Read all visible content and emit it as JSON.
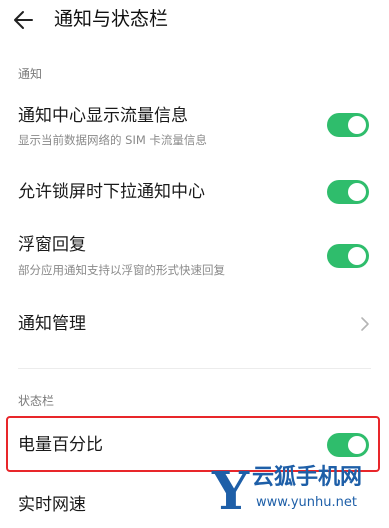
{
  "header": {
    "title": "通知与状态栏",
    "back_icon": "arrow-left-icon"
  },
  "sections": [
    {
      "label": "通知"
    },
    {
      "label": "状态栏"
    }
  ],
  "items": [
    {
      "title": "通知中心显示流量信息",
      "subtitle": "显示当前数据网络的 SIM 卡流量信息",
      "control": "toggle",
      "on": true
    },
    {
      "title": "允许锁屏时下拉通知中心",
      "control": "toggle",
      "on": true
    },
    {
      "title": "浮窗回复",
      "subtitle": "部分应用通知支持以浮窗的形式快速回复",
      "control": "toggle",
      "on": true
    },
    {
      "title": "通知管理",
      "control": "chevron"
    },
    {
      "title": "电量百分比",
      "control": "toggle",
      "on": true
    },
    {
      "title": "实时网速"
    }
  ],
  "colors": {
    "toggle_on": "#2fbd6c",
    "highlight": "#e8262a",
    "watermark": "#1e5fa8"
  },
  "watermark": {
    "letter": "Y",
    "name": "云狐手机网",
    "url": "www.yunhu.net"
  }
}
